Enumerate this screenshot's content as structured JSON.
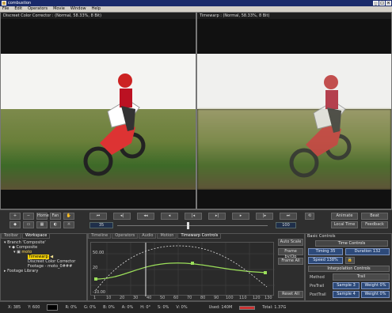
{
  "window": {
    "title": "combustion"
  },
  "menu": [
    "File",
    "Edit",
    "Operators",
    "Movie",
    "Window",
    "Help"
  ],
  "viewers": {
    "left_title": "Discreet Color Corrector : (Normal, 58.33%, 8 Bit)",
    "right_title": "Timewarp : (Normal, 58.33%, 8 Bit)"
  },
  "toolbar": {
    "plus": "+",
    "minus": "−",
    "home": "Home",
    "fan": "Fan",
    "frame_field": "35",
    "end_field": "100",
    "animate": "Animate",
    "beat": "Beat",
    "local_time": "Local Time",
    "feedback": "Feedback"
  },
  "workspace": {
    "tabs": [
      "Toolbar",
      "Workspace"
    ],
    "items": [
      "Branch 'Composite'",
      "Composite",
      "moto",
      "Timewarp",
      "Discreet Color Corrector",
      "Footage - moto_0###",
      "Footage Library"
    ]
  },
  "curves": {
    "tabs": [
      "Timeline",
      "Operators",
      "Audio",
      "Motion",
      "Timewarp Controls"
    ],
    "y_top": "50.00",
    "y_mid": "20",
    "y_bottom": "-10.00",
    "x_ticks": [
      "1",
      "10",
      "20",
      "30",
      "40",
      "50",
      "60",
      "70",
      "80",
      "90",
      "100",
      "110",
      "120",
      "130"
    ],
    "auto_scale": "Auto Scale",
    "frame_by_op": "Frame by/Op",
    "frame_all": "Frame All",
    "reset_all": "Reset All"
  },
  "basic_controls": {
    "header": "Basic Controls",
    "time_controls": "Time Controls",
    "timing": "Timing  35",
    "duration": "Duration  132",
    "speed": "Speed  138%",
    "interp_header": "Interpolation Controls",
    "method_label": "Method",
    "method_value": "Trail",
    "pre_trail": "PreTrail",
    "post_trail": "PostTrail",
    "sample3": "Sample 3",
    "weight_pre": "Weight 0%",
    "sample4": "Sample 4",
    "weight_post": "Weight 0%"
  },
  "status": {
    "x": "X:  385",
    "y": "Y:  600",
    "r": "R:  0%",
    "g": "G:  0%",
    "b": "B:  0%",
    "a": "A:  0%",
    "h": "H:  0°",
    "s": "S:  0%",
    "v": "V:  0%",
    "used": "Used:  140M",
    "total": "Total:  1.37G"
  }
}
